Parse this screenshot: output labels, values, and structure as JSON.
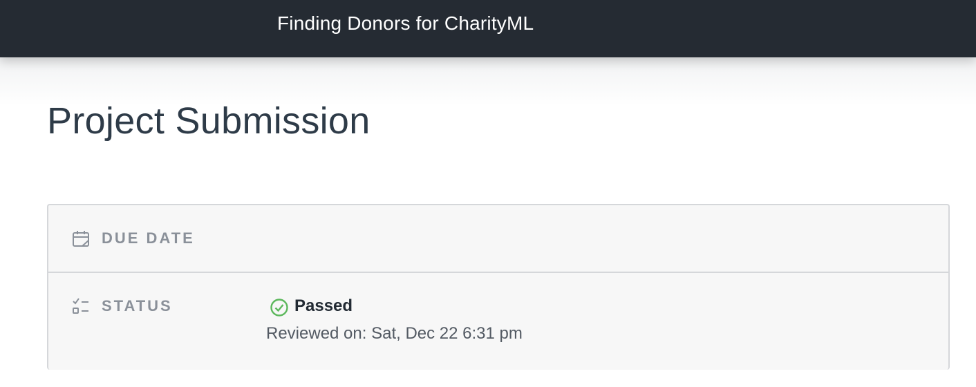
{
  "header": {
    "title": "Finding Donors for CharityML"
  },
  "page": {
    "title": "Project Submission"
  },
  "submission": {
    "due_date": {
      "label": "DUE DATE",
      "icon": "calendar-icon"
    },
    "status": {
      "label": "STATUS",
      "icon": "checklist-icon",
      "value": "Passed",
      "value_icon": "check-circle-icon",
      "value_color": "#5cb85c",
      "reviewed": "Reviewed on: Sat, Dec 22 6:31 pm"
    }
  }
}
